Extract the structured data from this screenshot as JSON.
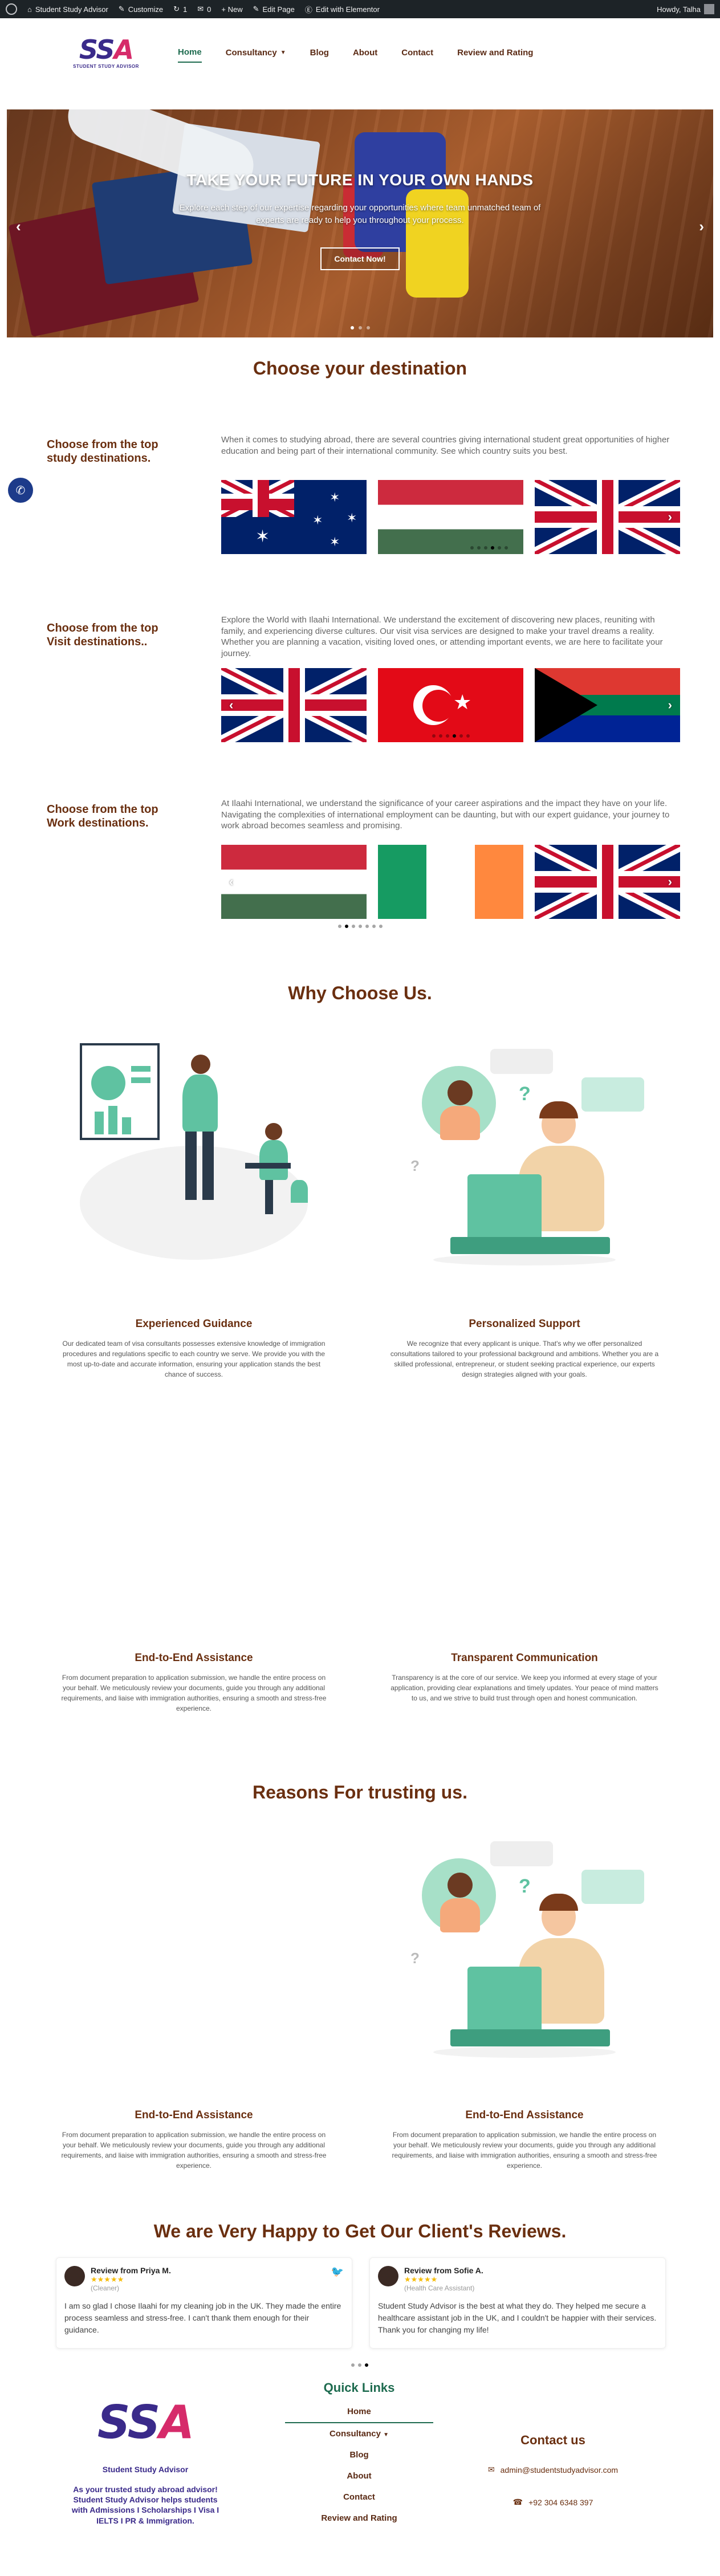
{
  "admin_bar": {
    "site_name": "Student Study Advisor",
    "customize": "Customize",
    "updates_count": "1",
    "comments_count": "0",
    "new_label": "+ New",
    "edit_page": "Edit Page",
    "edit_elementor": "Edit with Elementor",
    "howdy": "Howdy, Talha"
  },
  "logo": {
    "mark_a": "SS",
    "mark_b": "A",
    "subtitle": "STUDENT STUDY ADVISOR"
  },
  "nav": {
    "items": [
      {
        "label": "Home"
      },
      {
        "label": "Consultancy"
      },
      {
        "label": "Blog"
      },
      {
        "label": "About"
      },
      {
        "label": "Contact"
      },
      {
        "label": "Review and Rating"
      }
    ]
  },
  "hero": {
    "title": "TAKE YOUR FUTURE IN YOUR OWN HANDS",
    "text": "Explore each step of our expertise regarding your opportunities where team unmatched team of experts are ready to help you throughout your process.",
    "button": "Contact Now!",
    "prev": "‹",
    "next": "›"
  },
  "destinations": {
    "heading": "Choose your destination",
    "rows": [
      {
        "label": "Choose from the top study destinations.",
        "desc": "When it comes to studying abroad, there are several countries giving international student great opportunities of higher education and being part of their international community. See which country suits you best."
      },
      {
        "label": "Choose from the top Visit destinations..",
        "desc": "Explore the World with Ilaahi International. We understand the excitement of discovering new places, reuniting with family, and experiencing diverse cultures. Our visit visa services are designed to make your travel dreams a reality. Whether you are planning a vacation, visiting loved ones, or attending important events, we are here to facilitate your journey."
      },
      {
        "label": "Choose from the top Work destinations.",
        "desc": "At Ilaahi International, we understand the significance of your career aspirations and the impact they have on your life. Navigating the complexities of international employment can be daunting, but with our expert guidance, your journey to work abroad becomes seamless and promising."
      }
    ]
  },
  "why": {
    "heading": "Why Choose Us.",
    "cards": [
      {
        "title": "Experienced Guidance",
        "text": "Our dedicated team of visa consultants possesses extensive knowledge of immigration procedures and regulations specific to each country we serve. We provide you with the most up-to-date and accurate information, ensuring your application stands the best chance of success."
      },
      {
        "title": "Personalized Support",
        "text": "We recognize that every applicant is unique. That's why we offer personalized consultations tailored to your professional background and ambitions. Whether you are a skilled professional, entrepreneur, or student seeking practical experience, our experts design strategies aligned with your goals."
      },
      {
        "title": "End-to-End Assistance",
        "text": "From document preparation to application submission, we handle the entire process on your behalf. We meticulously review your documents, guide you through any additional requirements, and liaise with immigration authorities, ensuring a smooth and stress-free experience."
      },
      {
        "title": "Transparent Communication",
        "text": "Transparency is at the core of our service. We keep you informed at every stage of your application, providing clear explanations and timely updates. Your peace of mind matters to us, and we strive to build trust through open and honest communication."
      }
    ]
  },
  "trust": {
    "heading": "Reasons For trusting us.",
    "cards": [
      {
        "title": "End-to-End Assistance",
        "text": "From document preparation to application submission, we handle the entire process on your behalf. We meticulously review your documents, guide you through any additional requirements, and liaise with immigration authorities, ensuring a smooth and stress-free experience."
      },
      {
        "title": "End-to-End Assistance",
        "text": "From document preparation to application submission, we handle the entire process on your behalf. We meticulously review your documents, guide you through any additional requirements, and liaise with immigration authorities, ensuring a smooth and stress-free experience."
      }
    ]
  },
  "reviews": {
    "heading": "We are Very Happy to Get Our Client's Reviews.",
    "items": [
      {
        "name": "Review from Priya M.",
        "stars": "★★★★★",
        "role": "(Cleaner)",
        "text": "I am so glad I chose Ilaahi for my cleaning job in the UK. They made the entire process seamless and stress-free. I can't thank them enough for their guidance."
      },
      {
        "name": "Review from Sofie A.",
        "stars": "★★★★★",
        "role": "(Health Care Assistant)",
        "text": "Student Study Advisor is the best at what they do. They helped me secure a healthcare assistant job in the UK, and I couldn't be happier with their services. Thank you for changing my life!"
      }
    ]
  },
  "footer": {
    "quick_links_title": "Quick Links",
    "links": [
      "Home",
      "Consultancy",
      "Blog",
      "About",
      "Contact",
      "Review and Rating"
    ],
    "logo_caption": "Student Study Advisor",
    "tagline": "As your trusted study abroad advisor! Student Study Advisor helps students with Admissions I Scholarships I Visa I IELTS I PR & Immigration.",
    "contact_title": "Contact us",
    "email": "admin@studentstudyadvisor.com",
    "phone": "+92 304 6348 397"
  },
  "colors": {
    "brown": "#6a2f10",
    "green": "#1e6b4f",
    "star": "#f6bb06"
  }
}
